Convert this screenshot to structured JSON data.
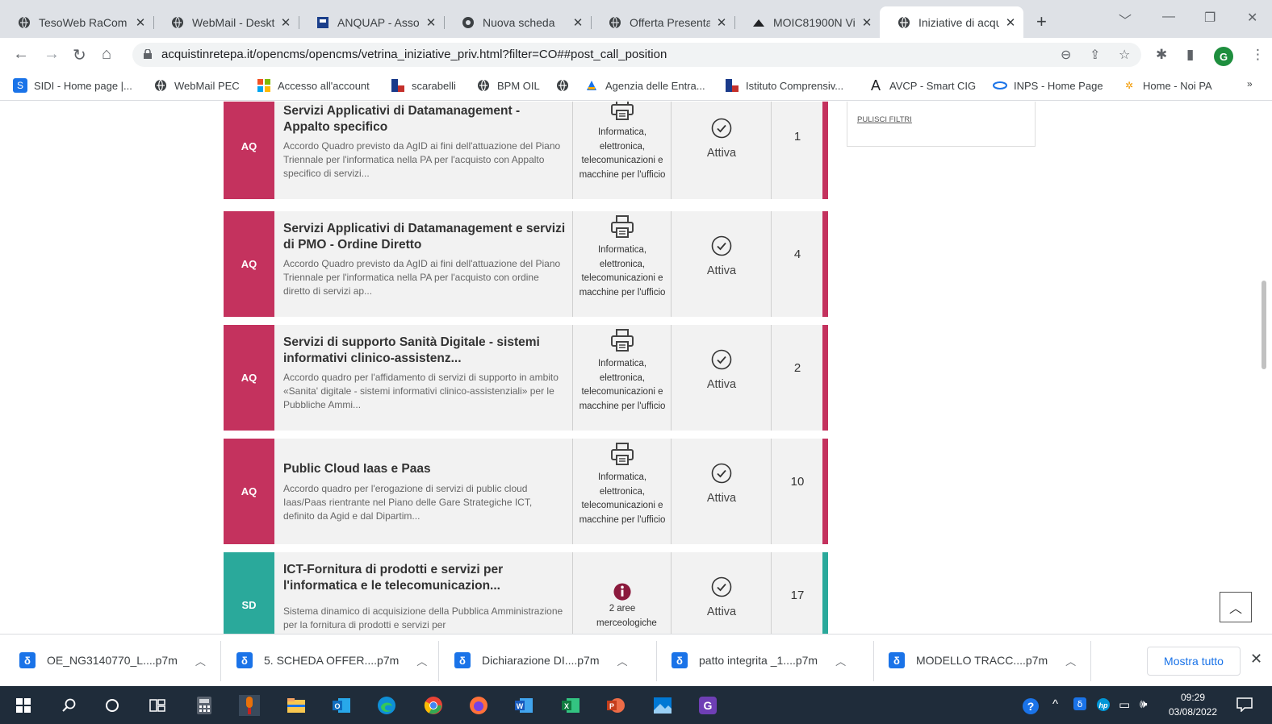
{
  "browser": {
    "tabs": [
      {
        "title": "TesoWeb RaCom",
        "active": false
      },
      {
        "title": "WebMail - Deskt",
        "active": false
      },
      {
        "title": "ANQUAP - Assoc",
        "active": false
      },
      {
        "title": "Nuova scheda",
        "active": false
      },
      {
        "title": "Offerta Presentat",
        "active": false
      },
      {
        "title": "MOIC81900N Vi",
        "active": false
      },
      {
        "title": "Iniziative di acqu",
        "active": true
      }
    ],
    "url": "acquistinretepa.it/opencms/opencms/vetrina_iniziative_priv.html?filter=CO##post_call_position",
    "profile_initial": "G"
  },
  "bookmarks": [
    "SIDI - Home page |...",
    "WebMail PEC",
    "Accesso all'account",
    "scarabelli",
    "BPM OIL",
    "",
    "Agenzia delle Entra...",
    "Istituto Comprensiv...",
    "AVCP - Smart CIG",
    "INPS - Home Page",
    "Home - Noi PA"
  ],
  "filters": {
    "clear_label": "PULISCI FILTRI"
  },
  "cards": [
    {
      "badge": "AQ",
      "color": "#c4325e",
      "title": "Servizi Applicativi di Datamanagement - Appalto specifico",
      "description": "Accordo Quadro previsto da AgID ai fini dell'attuazione del Piano Triennale per l'informatica nella PA per l'acquisto con Appalto specifico di servizi...",
      "category": "Informatica, elettronica, telecomunicazioni e macchine per l'ufficio",
      "category_icon": "printer-icon",
      "status": "Attiva",
      "count": "1"
    },
    {
      "badge": "AQ",
      "color": "#c4325e",
      "title": "Servizi Applicativi di Datamanagement e servizi di PMO - Ordine Diretto",
      "description": "Accordo Quadro previsto da AgID ai fini dell'attuazione del Piano Triennale per l'informatica nella PA per l'acquisto con ordine diretto di servizi ap...",
      "category": "Informatica, elettronica, telecomunicazioni e macchine per l'ufficio",
      "category_icon": "printer-icon",
      "status": "Attiva",
      "count": "4"
    },
    {
      "badge": "AQ",
      "color": "#c4325e",
      "title": "Servizi di supporto Sanità Digitale - sistemi informativi clinico-assistenz...",
      "description": "Accordo quadro per l'affidamento di servizi di supporto in ambito «Sanita' digitale - sistemi informativi clinico-assistenziali» per le Pubbliche Ammi...",
      "category": "Informatica, elettronica, telecomunicazioni e macchine per l'ufficio",
      "category_icon": "printer-icon",
      "status": "Attiva",
      "count": "2"
    },
    {
      "badge": "AQ",
      "color": "#c4325e",
      "title": "Public Cloud Iaas e Paas",
      "description": "Accordo quadro per l'erogazione di servizi di public cloud Iaas/Paas rientrante nel Piano delle Gare Strategiche ICT, definito da Agid e dal Dipartim...",
      "category": "Informatica, elettronica, telecomunicazioni e macchine per l'ufficio",
      "category_icon": "printer-icon",
      "status": "Attiva",
      "count": "10"
    },
    {
      "badge": "SD",
      "color": "#2aa99b",
      "title": "ICT-Fornitura di prodotti e servizi per l'informatica e le telecomunicazion...",
      "description": "Sistema dinamico di acquisizione della Pubblica Amministrazione per la fornitura di prodotti e servizi per",
      "category": "2 aree merceologiche",
      "category_icon": "info-icon",
      "status": "Attiva",
      "count": "17"
    }
  ],
  "downloads": [
    "OE_NG3140770_L....p7m",
    "5. SCHEDA OFFER....p7m",
    "Dichiarazione DI....p7m",
    "patto integrita _1....p7m",
    "MODELLO TRACC....p7m"
  ],
  "download_icon_glyph": "δ",
  "show_all_label": "Mostra tutto",
  "clock": {
    "time": "09:29",
    "date": "03/08/2022"
  }
}
